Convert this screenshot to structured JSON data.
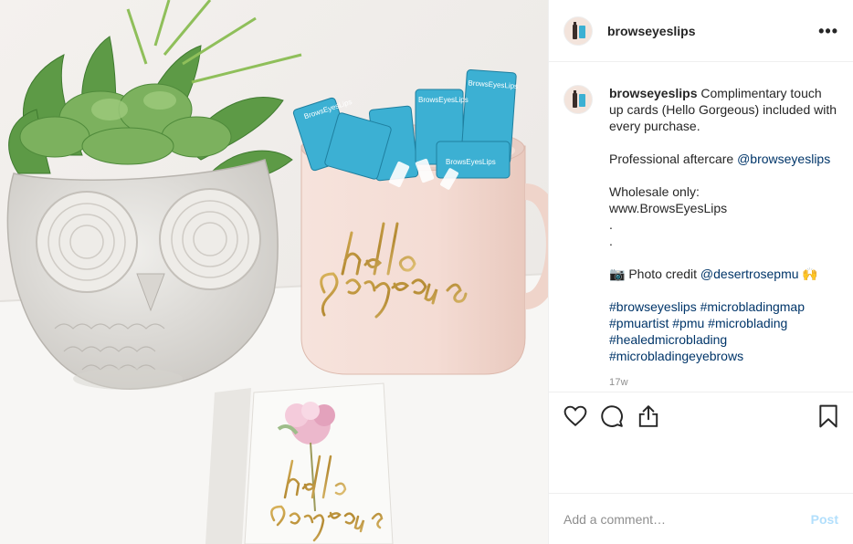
{
  "post": {
    "username": "browseyeslips",
    "more_label": "•••",
    "caption_user": "browseyeslips",
    "caption_line1": " Complimentary touch up cards (Hello Gorgeous) included with every purchase.",
    "caption_line2": "Professional aftercare ",
    "caption_mention1": "@browseyeslips",
    "caption_line3": "Wholesale only:\nwww.BrowsEyesLips\n.\n.",
    "caption_photo_credit": "📷 Photo credit ",
    "caption_mention2": "@desertrosepmu",
    "caption_emoji": " 🙌",
    "hashtags": [
      "#browseyeslips",
      "#microbladingmap",
      "#pmuartist",
      "#pmu",
      "#microblading",
      "#healedmicroblading",
      "#microbladingeyebrows"
    ],
    "timestamp": "17w"
  },
  "photo": {
    "mug_text": "hello gorgeous",
    "card_text": "hello gorgeous",
    "tube_label": "BrowsEyesLips"
  },
  "comment": {
    "placeholder": "Add a comment…",
    "post_label": "Post"
  },
  "colors": {
    "link": "#003569",
    "post_disabled": "#b2dffc",
    "tube": "#3cb0d3"
  }
}
